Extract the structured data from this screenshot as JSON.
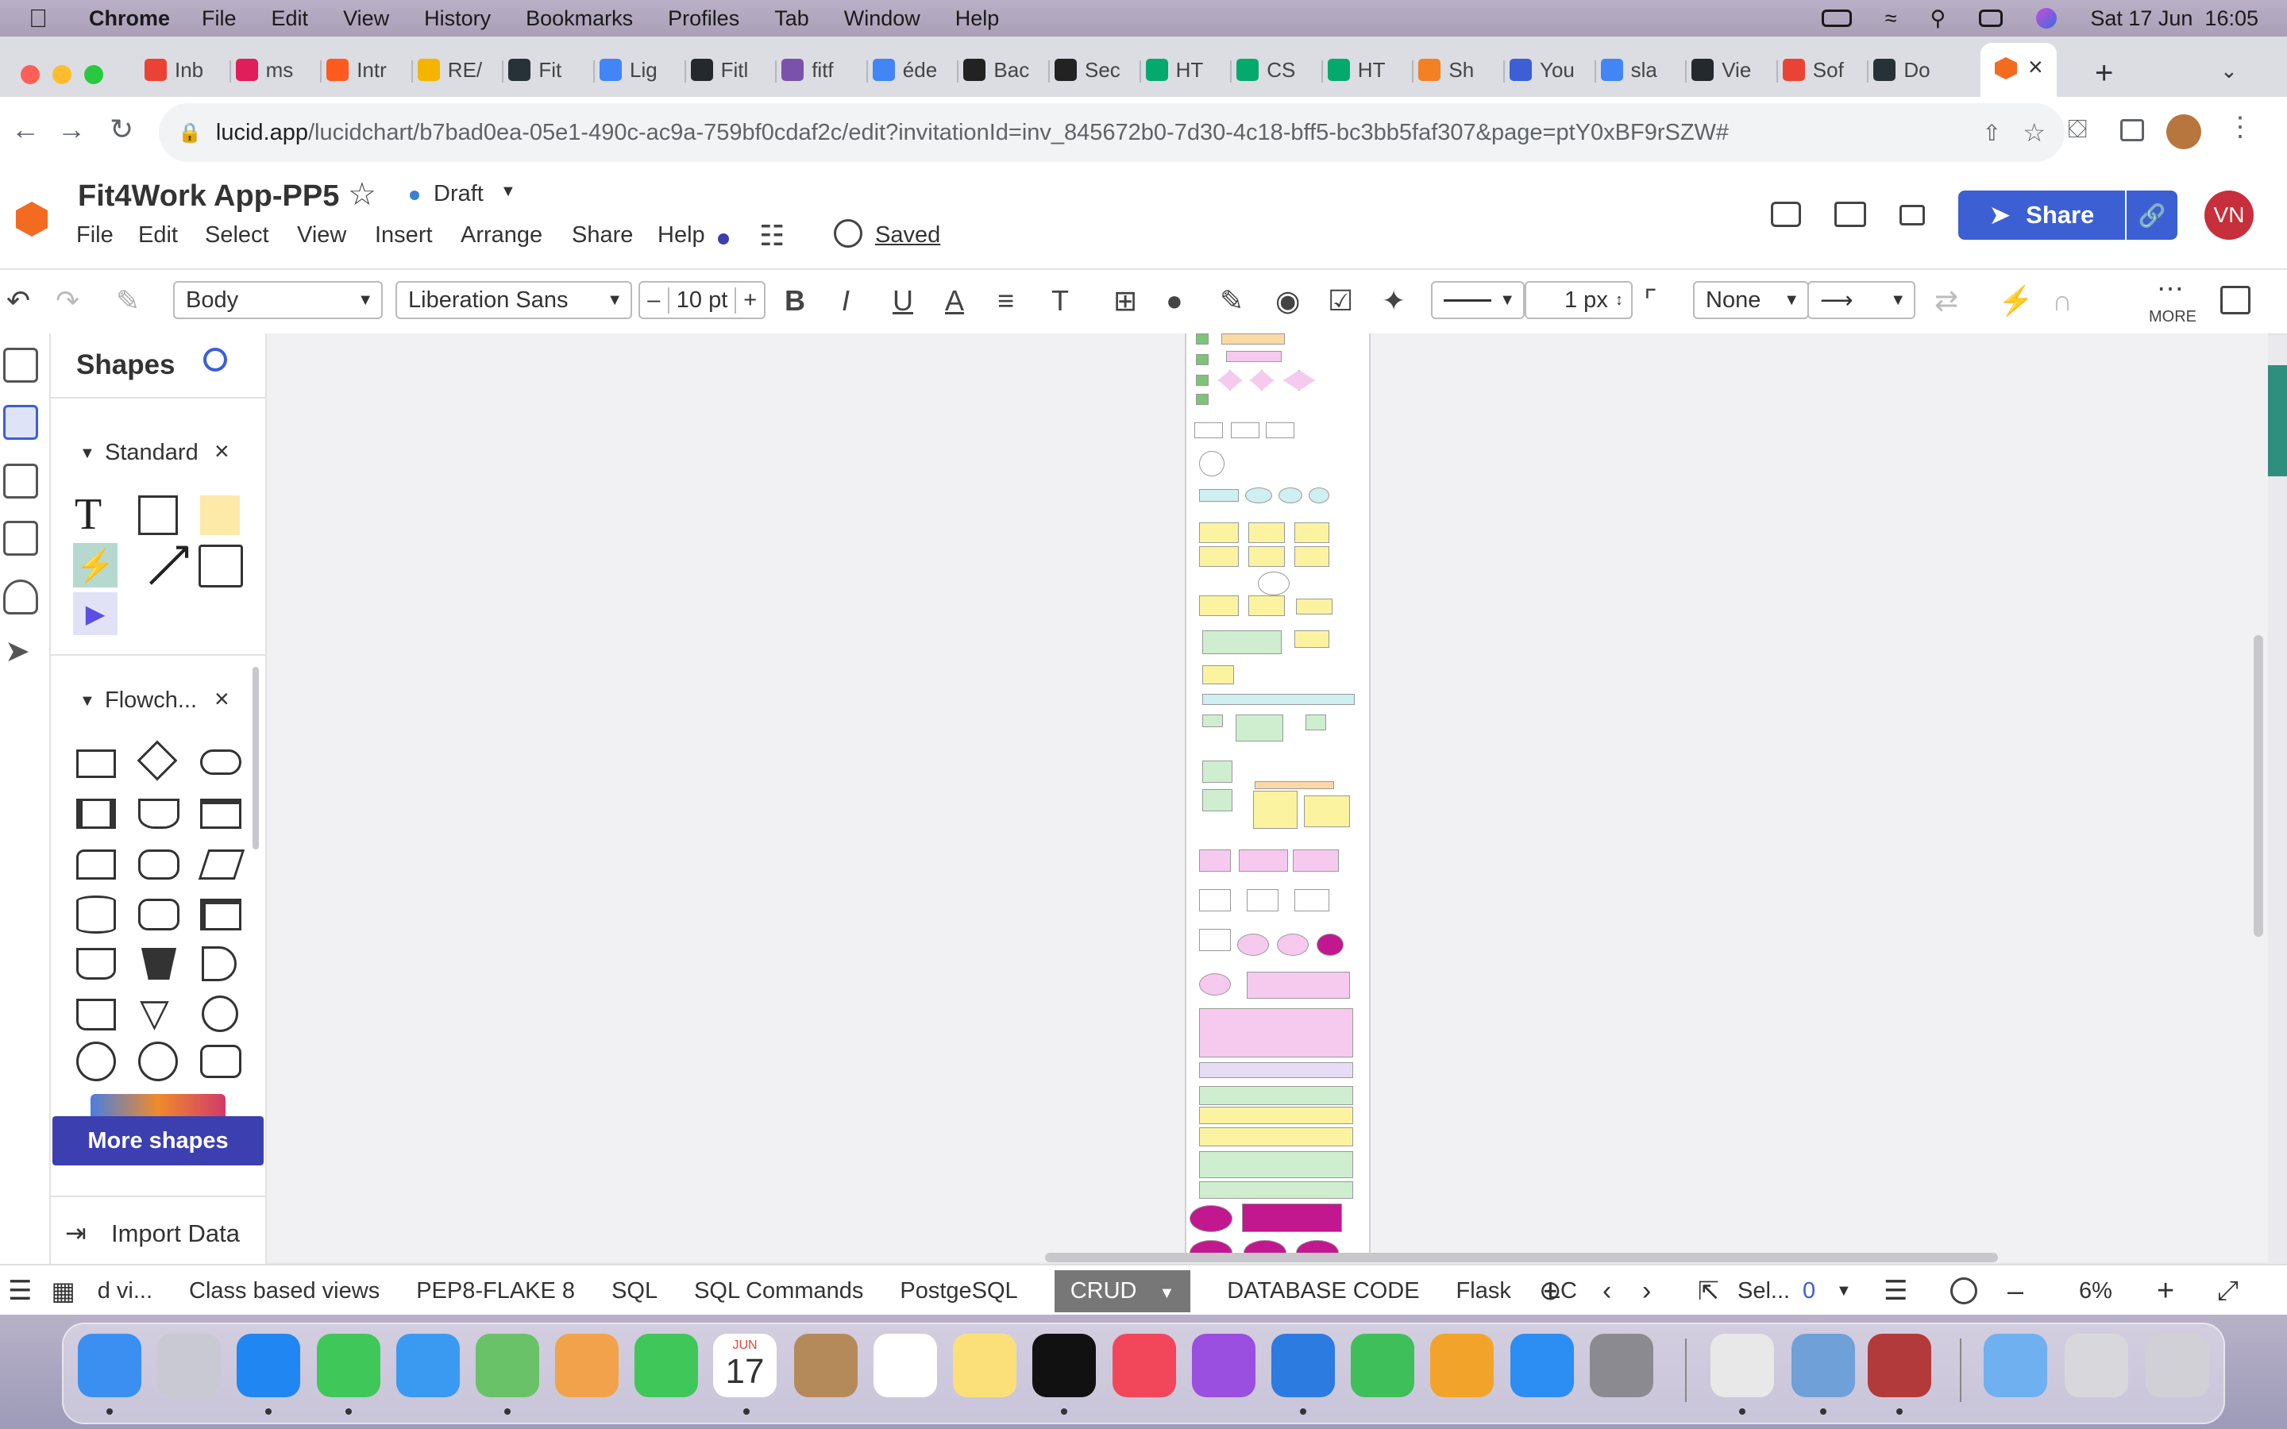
{
  "menubar": {
    "app": "Chrome",
    "items": [
      "File",
      "Edit",
      "View",
      "History",
      "Bookmarks",
      "Profiles",
      "Tab",
      "Window",
      "Help"
    ],
    "datetime": "Sat 17 Jun  16:05"
  },
  "tabs": [
    {
      "label": "Inb",
      "color": "#ea4335"
    },
    {
      "label": "ms",
      "color": "#e01e5a"
    },
    {
      "label": "Intr",
      "color": "#ff5a1f"
    },
    {
      "label": "RE/",
      "color": "#f4b400"
    },
    {
      "label": "Fit",
      "color": "#263238"
    },
    {
      "label": "Lig",
      "color": "#4285f4"
    },
    {
      "label": "Fitl",
      "color": "#24292e"
    },
    {
      "label": "fitf",
      "color": "#7b52ab"
    },
    {
      "label": "éde",
      "color": "#4285f4"
    },
    {
      "label": "Bac",
      "color": "#222222"
    },
    {
      "label": "Sec",
      "color": "#222222"
    },
    {
      "label": "HT",
      "color": "#04aa6d"
    },
    {
      "label": "CS",
      "color": "#04aa6d"
    },
    {
      "label": "HT",
      "color": "#04aa6d"
    },
    {
      "label": "Sh",
      "color": "#f48024"
    },
    {
      "label": "You",
      "color": "#3c5fd4"
    },
    {
      "label": "sla",
      "color": "#4285f4"
    },
    {
      "label": "Vie",
      "color": "#24292e"
    },
    {
      "label": "Sof",
      "color": "#ea4335"
    },
    {
      "label": "Do",
      "color": "#263238"
    }
  ],
  "address": {
    "host": "lucid.app",
    "path": "/lucidchart/b7bad0ea-05e1-490c-ac9a-759bf0cdaf2c/edit?invitationId=inv_845672b0-7d30-4c18-bff5-bc3bb5faf307&page=ptY0xBF9rSZW#"
  },
  "document": {
    "title": "Fit4Work App-PP5",
    "status": "Draft",
    "saved_label": "Saved",
    "menu": [
      "File",
      "Edit",
      "Select",
      "View",
      "Insert",
      "Arrange",
      "Share",
      "Help"
    ],
    "share_label": "Share",
    "avatar_initials": "VN"
  },
  "toolbar": {
    "text_style": "Body",
    "font": "Liberation Sans",
    "font_size": "10 pt",
    "line_width": "1 px",
    "line_end": "None",
    "more_label": "MORE"
  },
  "shapes_panel": {
    "title": "Shapes",
    "section_standard": "Standard",
    "section_flowchart": "Flowch...",
    "more_shapes": "More shapes",
    "import_data": "Import Data"
  },
  "page_tabs": {
    "items": [
      "d vi...",
      "Class based views",
      "PEP8-FLAKE 8",
      "SQL",
      "SQL Commands",
      "PostgeSQL",
      "CRUD",
      "DATABASE CODE",
      "Flask",
      "LC"
    ],
    "active": "CRUD",
    "selection_label": "Sel...",
    "selection_count": "0",
    "zoom": "6%"
  },
  "dock": {
    "calendar_month": "JUN",
    "calendar_day": "17"
  },
  "colors": {
    "brand_blue": "#3c5fd4",
    "lucid_orange": "#f26b21",
    "avatar": "#c62f3b"
  }
}
